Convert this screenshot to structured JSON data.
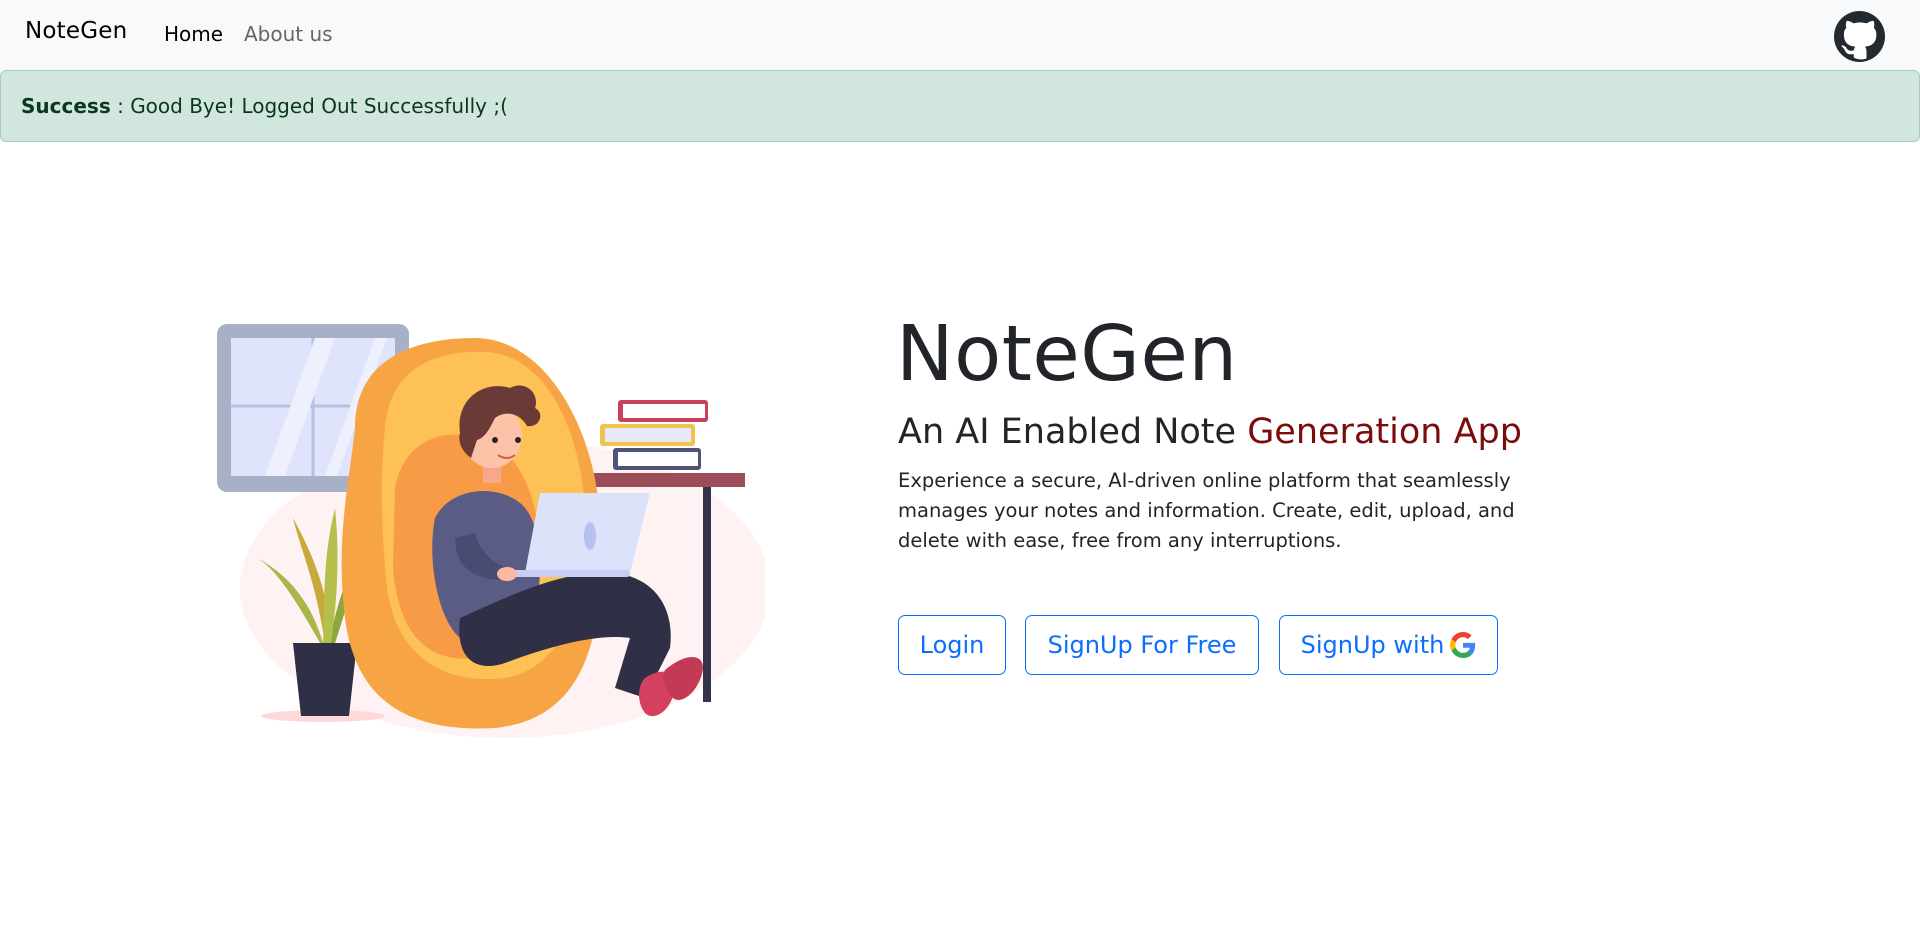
{
  "navbar": {
    "brand": "NoteGen",
    "links": [
      {
        "label": "Home"
      },
      {
        "label": "About us"
      }
    ],
    "github_icon": "github-icon"
  },
  "alert": {
    "strong": "Success",
    "message": " : Good Bye! Logged Out Successfully ;("
  },
  "hero": {
    "title": "NoteGen",
    "subtitle_plain": "An AI Enabled Note ",
    "subtitle_accent": "Generation App",
    "description": "Experience a secure, AI-driven online platform that seamlessly manages your notes and information. Create, edit, upload, and delete with ease, free from any interruptions.",
    "buttons": {
      "login": "Login",
      "signup": "SignUp For Free",
      "google": "SignUp with"
    },
    "illustration_icon": "person-with-laptop-illustration"
  },
  "colors": {
    "accent": "#7a0c0c",
    "primary": "#0d6efd",
    "alert_bg": "#d1e7dd",
    "navbar_bg": "#f8f9fa"
  }
}
